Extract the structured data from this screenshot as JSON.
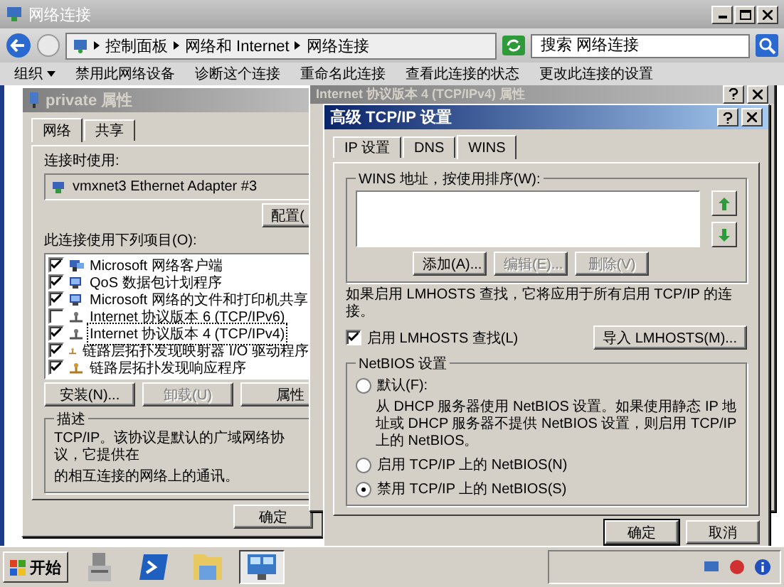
{
  "explorer": {
    "title": "网络连接",
    "crumbs": [
      "控制面板",
      "网络和 Internet",
      "网络连接"
    ],
    "search": {
      "placeholder": "搜索 网络连接"
    },
    "toolbar": [
      {
        "label": "组织",
        "menu": true
      },
      {
        "label": "禁用此网络设备",
        "menu": false
      },
      {
        "label": "诊断这个连接",
        "menu": false
      },
      {
        "label": "重命名此连接",
        "menu": false
      },
      {
        "label": "查看此连接的状态",
        "menu": false
      },
      {
        "label": "更改此连接的设置",
        "menu": false
      }
    ]
  },
  "properties_window": {
    "title": "private 属性",
    "tabs": [
      {
        "label": "网络",
        "selected": true
      },
      {
        "label": "共享",
        "selected": false
      }
    ],
    "connect_using_label": "连接时使用:",
    "adapter": "vmxnet3 Ethernet Adapter #3",
    "configure_button": "配置(",
    "items_label": "此连接使用下列项目(O):",
    "items": [
      {
        "label": "Microsoft 网络客户端",
        "checked": true,
        "selected": false,
        "kind": "client"
      },
      {
        "label": "QoS 数据包计划程序",
        "checked": true,
        "selected": false,
        "kind": "service"
      },
      {
        "label": "Microsoft 网络的文件和打印机共享",
        "checked": true,
        "selected": false,
        "kind": "service"
      },
      {
        "label": "Internet 协议版本 6 (TCP/IPv6)",
        "checked": false,
        "selected": false,
        "kind": "protocol"
      },
      {
        "label": "Internet 协议版本 4 (TCP/IPv4)",
        "checked": true,
        "selected": true,
        "kind": "protocol"
      },
      {
        "label": "链路层拓扑发现映射器 I/O 驱动程序",
        "checked": true,
        "selected": false,
        "kind": "link"
      },
      {
        "label": "链路层拓扑发现响应程序",
        "checked": true,
        "selected": false,
        "kind": "link"
      }
    ],
    "buttons": [
      {
        "label": "安装(N)...",
        "disabled": false
      },
      {
        "label": "卸载(U)",
        "disabled": true
      },
      {
        "label": "属性",
        "disabled": false
      }
    ],
    "description_title": "描述",
    "description_lines": [
      "TCP/IP。该协议是默认的广域网络协议，它提供在",
      "的相互连接的网络上的通讯。"
    ],
    "ok_button": "确定"
  },
  "ipv4_window": {
    "title": "Internet 协议版本 4 (TCP/IPv4) 属性"
  },
  "advanced_dialog": {
    "title": "高级 TCP/IP 设置",
    "tabs": [
      {
        "label": "IP 设置",
        "selected": false
      },
      {
        "label": "DNS",
        "selected": false
      },
      {
        "label": "WINS",
        "selected": true
      }
    ],
    "wins_label": "WINS 地址，按使用排序(W):",
    "wins_buttons": [
      {
        "label": "添加(A)...",
        "disabled": false
      },
      {
        "label": "编辑(E)...",
        "disabled": true
      },
      {
        "label": "删除(V)",
        "disabled": true
      }
    ],
    "lmhosts_note": "如果启用 LMHOSTS 查找，它将应用于所有启用 TCP/IP 的连接。",
    "lmhosts_checkbox": {
      "label": "启用 LMHOSTS 查找(L)",
      "checked": true
    },
    "import_button": "导入 LMHOSTS(M)...",
    "netbios_label": "NetBIOS 设置",
    "netbios_options": [
      {
        "label": "默认(F):",
        "selected": false,
        "note": "从 DHCP 服务器使用 NetBIOS 设置。如果使用静态 IP 地址或 DHCP 服务器不提供 NetBIOS 设置，则启用 TCP/IP 上的 NetBIOS。"
      },
      {
        "label": "启用 TCP/IP 上的 NetBIOS(N)",
        "selected": false
      },
      {
        "label": "禁用 TCP/IP 上的 NetBIOS(S)",
        "selected": true
      }
    ],
    "ok_button": "确定",
    "cancel_button": "取消"
  },
  "taskbar": {
    "start": "开始",
    "apps": [
      {
        "kind": "server",
        "selected": false
      },
      {
        "kind": "shell",
        "selected": false
      },
      {
        "kind": "folder",
        "selected": false
      },
      {
        "kind": "network",
        "selected": true
      }
    ]
  }
}
